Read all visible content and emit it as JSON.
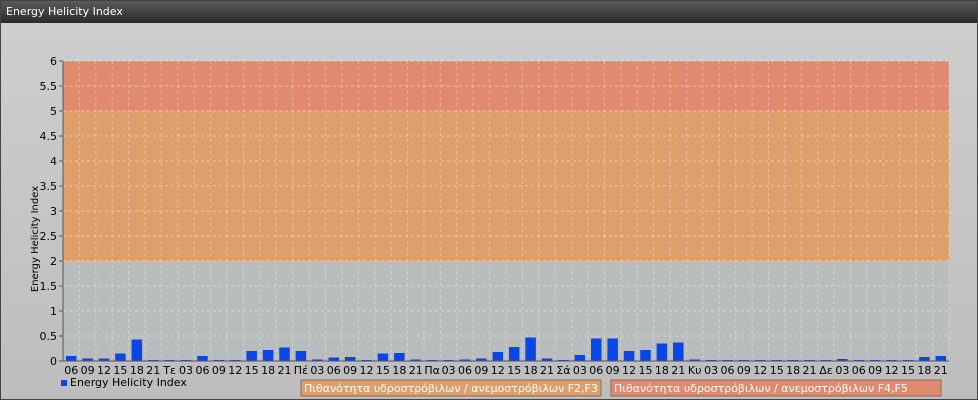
{
  "window": {
    "title": "Energy Helicity Index"
  },
  "chart_data": {
    "type": "bar",
    "title": "",
    "ylabel": "Energy Helicity Index",
    "ylim": [
      0,
      6
    ],
    "yticks": [
      "0",
      "0.5",
      "1",
      "1.5",
      "2",
      "2.5",
      "3",
      "3.5",
      "4",
      "4.5",
      "5",
      "5.5",
      "6"
    ],
    "xtick_labels": [
      "06",
      "09",
      "12",
      "15",
      "18",
      "21",
      "Τε",
      "03",
      "06",
      "09",
      "12",
      "15",
      "18",
      "21",
      "Πέ",
      "03",
      "06",
      "09",
      "12",
      "15",
      "18",
      "21",
      "Πα",
      "03",
      "06",
      "09",
      "12",
      "15",
      "18",
      "21",
      "Σά",
      "03",
      "06",
      "09",
      "12",
      "15",
      "18",
      "21",
      "Κυ",
      "03",
      "06",
      "09",
      "12",
      "15",
      "18",
      "21",
      "Δε",
      "03",
      "06",
      "09",
      "12",
      "15",
      "18",
      "21"
    ],
    "series": [
      {
        "name": "Energy Helicity Index",
        "color": "#0a46e6",
        "values": [
          0.1,
          0.05,
          0.05,
          0.15,
          0.43,
          0.02,
          0.02,
          0.02,
          0.1,
          0.02,
          0.02,
          0.2,
          0.22,
          0.27,
          0.2,
          0.03,
          0.07,
          0.08,
          0.02,
          0.15,
          0.16,
          0.03,
          0.02,
          0.02,
          0.03,
          0.05,
          0.18,
          0.28,
          0.47,
          0.05,
          0.02,
          0.12,
          0.45,
          0.45,
          0.2,
          0.22,
          0.35,
          0.37,
          0.03,
          0.02,
          0.02,
          0.02,
          0.02,
          0.02,
          0.02,
          0.02,
          0.02,
          0.04,
          0.02,
          0.02,
          0.02,
          0.02,
          0.08,
          0.1
        ]
      }
    ],
    "bands": [
      {
        "from": 0,
        "to": 2,
        "color": "#b9bcbd"
      },
      {
        "from": 2,
        "to": 5,
        "color": "#dda06c",
        "legend": "Πιθανότητα υδροστρόβιλων / ανεμοστρόβιλων F2,F3"
      },
      {
        "from": 5,
        "to": 6,
        "color": "#e08a70",
        "legend": "Πιθανότητα υδροστρόβιλων / ανεμοστρόβιλων F4,F5"
      }
    ],
    "grid": true,
    "legend_position": "bottom"
  }
}
